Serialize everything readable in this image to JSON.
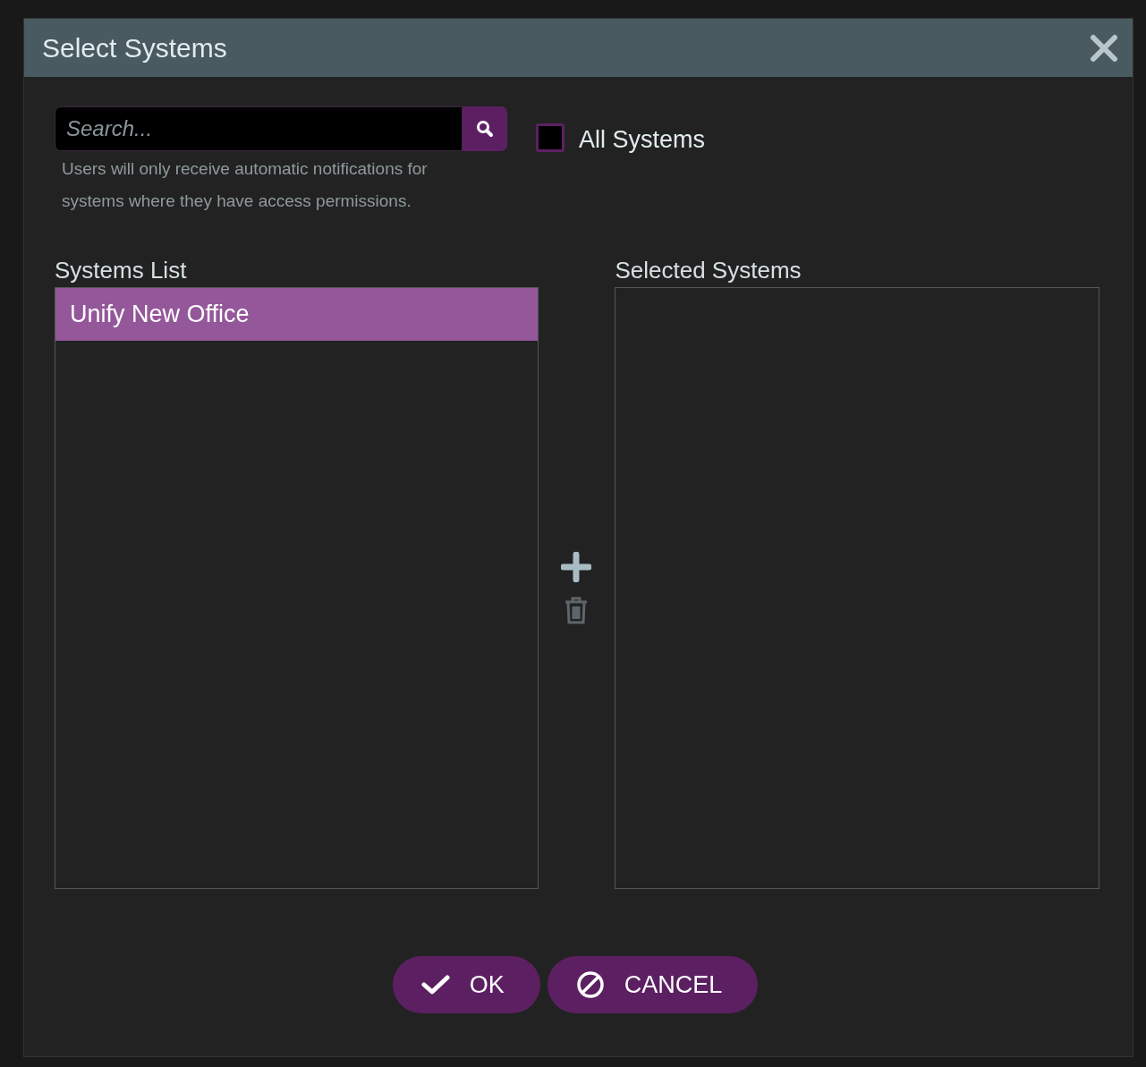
{
  "dialog": {
    "title": "Select Systems"
  },
  "search": {
    "placeholder": "Search..."
  },
  "hint": "Users will only receive automatic notifications for systems where they have access permissions.",
  "all_systems": {
    "label": "All Systems",
    "checked": false
  },
  "systems_list": {
    "label": "Systems List",
    "items": [
      {
        "label": "Unify New Office",
        "selected": true
      }
    ]
  },
  "selected_systems": {
    "label": "Selected Systems"
  },
  "buttons": [
    {
      "kind": "ok",
      "label": "OK"
    },
    {
      "kind": "cancel",
      "label": "CANCEL"
    }
  ]
}
